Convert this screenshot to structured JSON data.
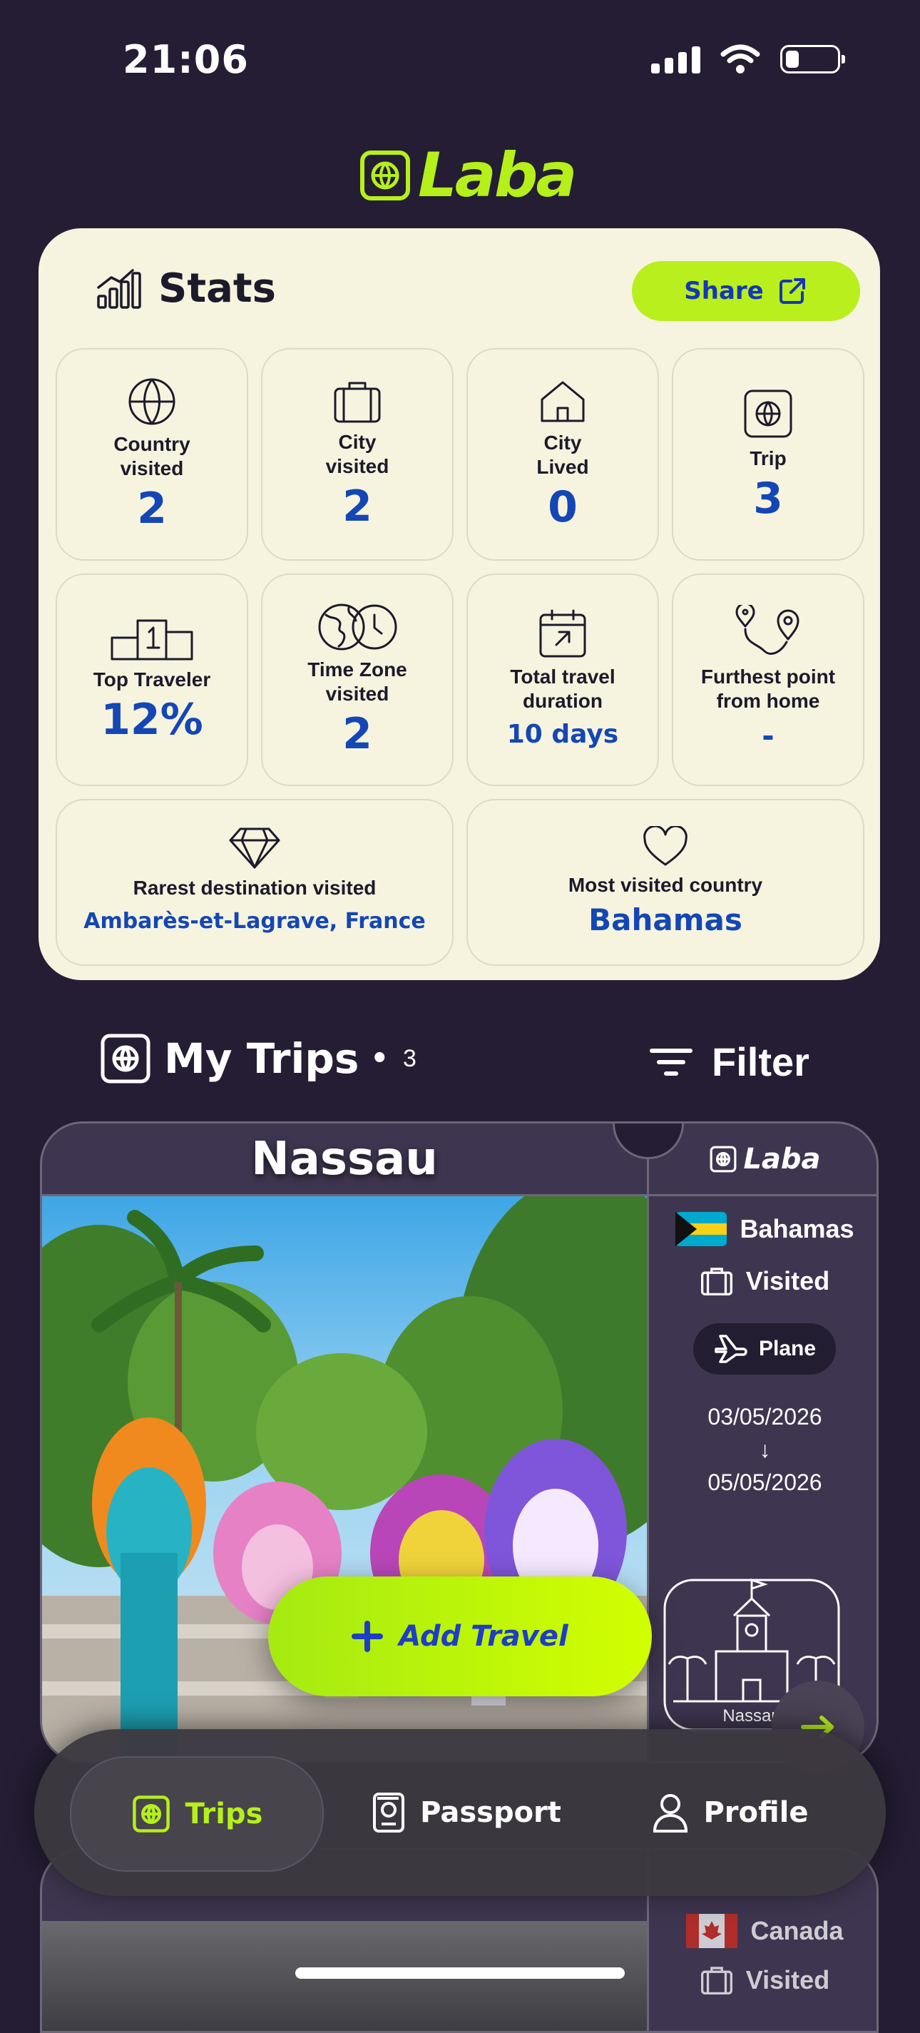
{
  "status_bar": {
    "time": "21:06"
  },
  "app": {
    "logo_text": "Laba"
  },
  "stats": {
    "title": "Stats",
    "share_label": "Share",
    "tiles": [
      {
        "label": "Country visited",
        "value": "2",
        "icon": "globe-icon"
      },
      {
        "label": "City visited",
        "value": "2",
        "icon": "suitcase-icon"
      },
      {
        "label": "City Lived",
        "value": "0",
        "icon": "house-icon"
      },
      {
        "label": "Trip",
        "value": "3",
        "icon": "ticket-globe-icon"
      },
      {
        "label": "Top Traveler",
        "value": "12%",
        "icon": "podium-icon"
      },
      {
        "label": "Time Zone visited",
        "value": "2",
        "icon": "globe-clock-icon"
      },
      {
        "label": "Total travel duration",
        "value": "10 days",
        "icon": "calendar-icon"
      },
      {
        "label": "Furthest point from home",
        "value": "-",
        "icon": "route-pin-icon"
      },
      {
        "label": "Rarest destination visited",
        "value": "Ambarès-et-Lagrave, France",
        "icon": "diamond-icon"
      },
      {
        "label": "Most visited country",
        "value": "Bahamas",
        "icon": "heart-icon"
      }
    ]
  },
  "trips": {
    "title": "My Trips",
    "count": "3",
    "filter_label": "Filter",
    "cards": [
      {
        "city": "Nassau",
        "country": "Bahamas",
        "status": "Visited",
        "transport": "Plane",
        "start_date": "03/05/2026",
        "arrow": "↓",
        "end_date": "05/05/2026",
        "stamp_text": "Nassau",
        "side_logo": "Laba"
      },
      {
        "country": "Canada",
        "status": "Visited"
      }
    ]
  },
  "add_travel_label": "Add Travel",
  "nav": {
    "items": [
      {
        "label": "Trips",
        "active": true
      },
      {
        "label": "Passport",
        "active": false
      },
      {
        "label": "Profile",
        "active": false
      }
    ]
  },
  "colors": {
    "background": "#241d33",
    "card": "#f6f4df",
    "accent": "#b5f01a",
    "value_blue": "#1447b5"
  }
}
